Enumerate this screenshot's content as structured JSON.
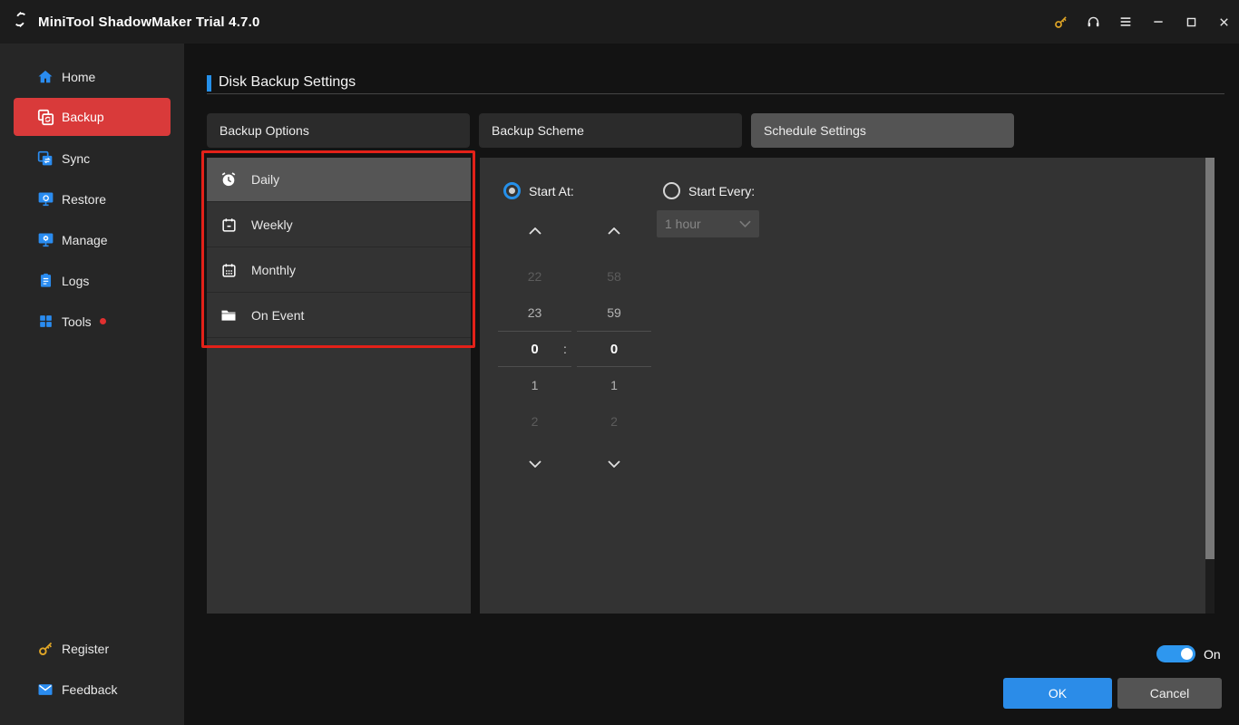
{
  "colors": {
    "accent_blue": "#2590ea",
    "brand_red": "#d93a3a",
    "key_gold": "#dfa526",
    "toggle_on_blue": "#2e97ef",
    "annotation_red": "#e32119"
  },
  "window": {
    "title": "MiniTool ShadowMaker Trial 4.7.0",
    "titlebar_icons": [
      "key-icon",
      "headset-icon",
      "menu-icon",
      "minimize-icon",
      "maximize-icon",
      "close-icon"
    ]
  },
  "sidebar": {
    "items": [
      {
        "label": "Home",
        "icon": "home-icon",
        "active": false
      },
      {
        "label": "Backup",
        "icon": "backup-icon",
        "active": true
      },
      {
        "label": "Sync",
        "icon": "sync-icon",
        "active": false
      },
      {
        "label": "Restore",
        "icon": "restore-icon",
        "active": false
      },
      {
        "label": "Manage",
        "icon": "manage-icon",
        "active": false
      },
      {
        "label": "Logs",
        "icon": "logs-icon",
        "active": false
      },
      {
        "label": "Tools",
        "icon": "tools-icon",
        "active": false,
        "badge": "red-dot"
      }
    ],
    "bottom_items": [
      {
        "label": "Register",
        "icon": "key-icon"
      },
      {
        "label": "Feedback",
        "icon": "mail-icon"
      }
    ]
  },
  "main": {
    "page_title": "Disk Backup Settings",
    "tabs": [
      {
        "label": "Backup Options",
        "active": false
      },
      {
        "label": "Backup Scheme",
        "active": false
      },
      {
        "label": "Schedule Settings",
        "active": true
      }
    ],
    "schedule_options": [
      {
        "label": "Daily",
        "icon": "alarm-clock-icon",
        "selected": true
      },
      {
        "label": "Weekly",
        "icon": "calendar-week-icon",
        "selected": false
      },
      {
        "label": "Monthly",
        "icon": "calendar-month-icon",
        "selected": false
      },
      {
        "label": "On Event",
        "icon": "folder-icon",
        "selected": false
      }
    ],
    "schedule_panel": {
      "start_at_label": "Start At:",
      "start_every_label": "Start Every:",
      "start_at_selected": true,
      "interval_value": "1 hour",
      "interval_enabled": false,
      "time_picker": {
        "hours": [
          "22",
          "23",
          "0",
          "1",
          "2"
        ],
        "minutes": [
          "58",
          "59",
          "0",
          "1",
          "2"
        ],
        "selected_hour": "0",
        "selected_minute": "0",
        "separator": ":"
      }
    }
  },
  "footer": {
    "toggle_state": "On",
    "ok_label": "OK",
    "cancel_label": "Cancel"
  }
}
